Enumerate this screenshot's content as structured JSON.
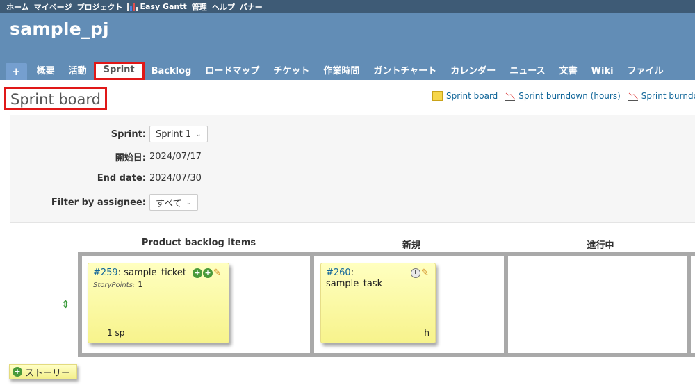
{
  "top_menu": {
    "items": [
      "ホーム",
      "マイページ",
      "プロジェクト",
      "Easy Gantt",
      "管理",
      "ヘルプ",
      "バナー"
    ]
  },
  "project": {
    "title": "sample_pj"
  },
  "main_menu": {
    "plus": "+",
    "tabs": [
      "概要",
      "活動",
      "Sprint",
      "Backlog",
      "ロードマップ",
      "チケット",
      "作業時間",
      "ガントチャート",
      "カレンダー",
      "ニュース",
      "文書",
      "Wiki",
      "ファイル"
    ],
    "selected": "Sprint"
  },
  "page": {
    "title": "Sprint board"
  },
  "contextual": {
    "links": [
      "Sprint board",
      "Sprint burndown (hours)",
      "Sprint burndo"
    ]
  },
  "filters": {
    "sprint_label": "Sprint:",
    "sprint_value": "Sprint 1",
    "start_label": "開始日:",
    "start_value": "2024/07/17",
    "end_label": "End date:",
    "end_value": "2024/07/30",
    "assignee_label": "Filter by assignee:",
    "assignee_value": "すべて"
  },
  "board": {
    "columns": [
      "Product backlog items",
      "新規",
      "進行中"
    ],
    "story": {
      "number": "#259",
      "title": "sample_ticket",
      "points_label": "StoryPoints:",
      "points_value": "1",
      "footer": "1 sp"
    },
    "task": {
      "number": "#260",
      "title": "sample_task",
      "footer": "h"
    },
    "add_story_label": "ストーリー",
    "sort_handle": "⇕"
  },
  "colors": {
    "header": "#628db6",
    "top_menu": "#3e5b76",
    "highlight": "#e01818",
    "card": "#ffffc0"
  }
}
